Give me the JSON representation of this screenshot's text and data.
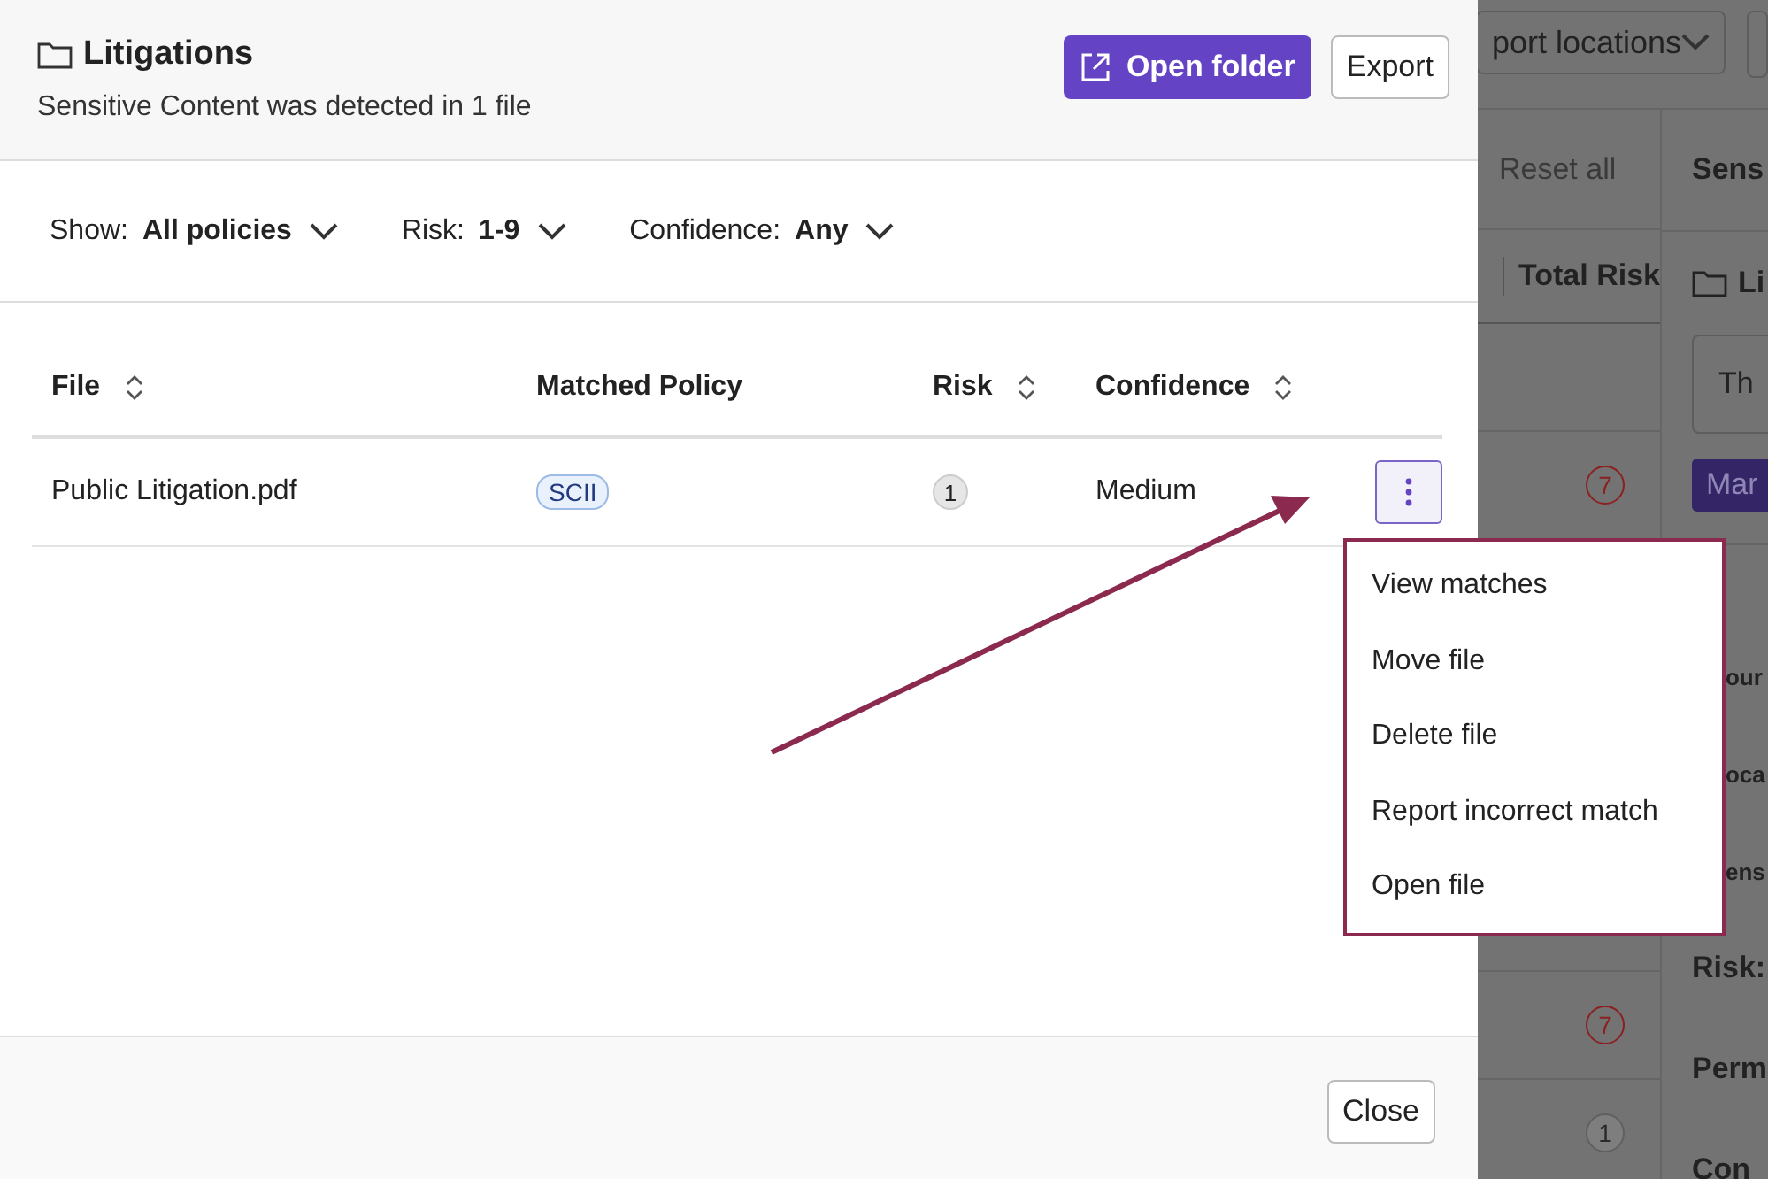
{
  "modal": {
    "title": "Litigations",
    "subtitle": "Sensitive Content was detected in 1 file",
    "buttons": {
      "open_folder": "Open folder",
      "export": "Export"
    },
    "filters": [
      {
        "label": "Show:",
        "value": "All policies"
      },
      {
        "label": "Risk:",
        "value": "1-9"
      },
      {
        "label": "Confidence:",
        "value": "Any"
      }
    ],
    "table": {
      "columns": [
        {
          "label": "File",
          "sortable": true
        },
        {
          "label": "Matched Policy",
          "sortable": false
        },
        {
          "label": "Risk",
          "sortable": true
        },
        {
          "label": "Confidence",
          "sortable": true
        }
      ],
      "rows": [
        {
          "file": "Public Litigation.pdf",
          "policy": "SCII",
          "risk": "1",
          "confidence": "Medium",
          "menu_open": true
        }
      ]
    },
    "row_menu": {
      "items": [
        "View matches",
        "Move file",
        "Delete file",
        "Report incorrect match",
        "Open file"
      ]
    },
    "footer": {
      "close": "Close"
    }
  },
  "background": {
    "dropdown": "port locations",
    "reset_all": "Reset all",
    "total_risk": "Total Risk",
    "risk_badges": [
      "7",
      "7",
      "1"
    ],
    "panel": {
      "heading": "Sens",
      "folder": "Li",
      "field": "Th",
      "button": "Mar",
      "labels": [
        "our",
        "oca",
        "ens",
        "Risk:",
        "Perm",
        "Con"
      ]
    }
  }
}
